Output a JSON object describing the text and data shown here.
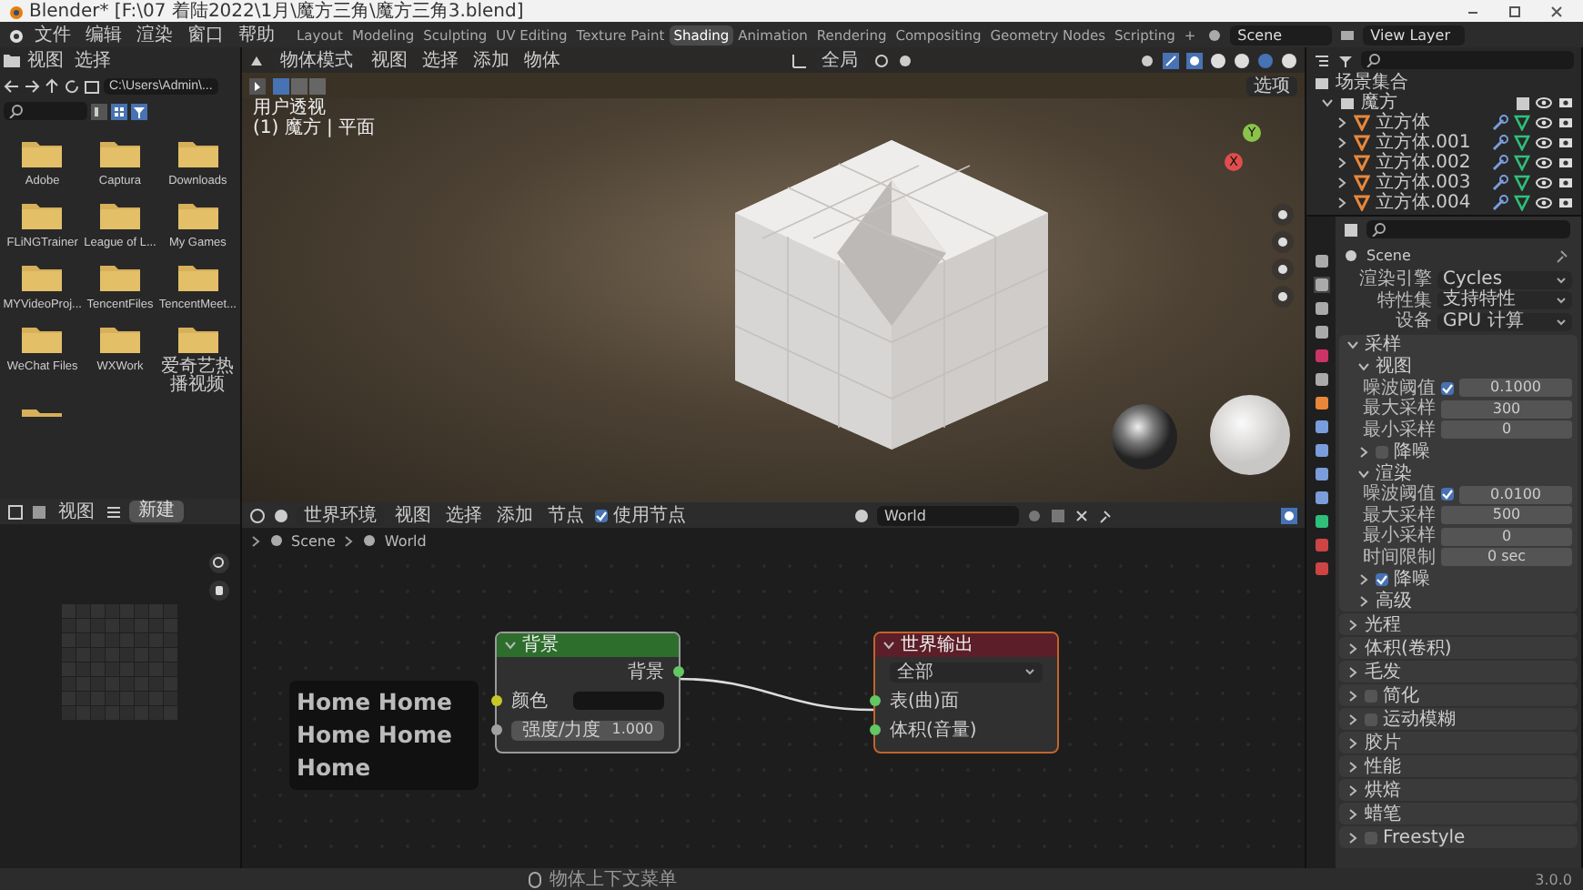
{
  "window": {
    "title": "Blender* [F:\\07 着陆2022\\1月\\魔方三角\\魔方三角3.blend]"
  },
  "menu": [
    "文件",
    "编辑",
    "渲染",
    "窗口",
    "帮助"
  ],
  "workspaces": [
    {
      "label": "Layout",
      "selected": false
    },
    {
      "label": "Modeling",
      "selected": false
    },
    {
      "label": "Sculpting",
      "selected": false
    },
    {
      "label": "UV Editing",
      "selected": false
    },
    {
      "label": "Texture Paint",
      "selected": false
    },
    {
      "label": "Shading",
      "selected": true
    },
    {
      "label": "Animation",
      "selected": false
    },
    {
      "label": "Rendering",
      "selected": false
    },
    {
      "label": "Compositing",
      "selected": false
    },
    {
      "label": "Geometry Nodes",
      "selected": false
    },
    {
      "label": "Scripting",
      "selected": false
    }
  ],
  "add_workspace": "+",
  "scene": "Scene",
  "view_layer": "View Layer",
  "file_browser": {
    "menu": [
      "视图",
      "选择"
    ],
    "path": "C:\\Users\\Admin\\...",
    "folders": [
      "Adobe",
      "Captura",
      "Downloads",
      "FLiNGTrainer",
      "League of L...",
      "My Games",
      "MYVideoProj...",
      "TencentFiles",
      "TencentMeet...",
      "WeChat Files",
      "WXWork",
      "爱奇艺热播视频"
    ]
  },
  "image_editor": {
    "view_menu": "视图",
    "new_button": "新建"
  },
  "viewport": {
    "mode": "物体模式",
    "menu": [
      "视图",
      "选择",
      "添加",
      "物体"
    ],
    "orientation": "全局",
    "view_name": "用户透视",
    "object_info": "(1) 魔方 | 平面",
    "options": "选项",
    "gizmo_axes": [
      "Y",
      "X"
    ]
  },
  "node_editor": {
    "type": "世界环境",
    "menu": [
      "视图",
      "选择",
      "添加",
      "节点"
    ],
    "use_nodes": {
      "label": "使用节点",
      "checked": true
    },
    "world": "World",
    "breadcrumbs": [
      "Scene",
      "World"
    ],
    "keystrokes": "Home Home Home Home Home",
    "background_node": {
      "title": "背景",
      "output": "背景",
      "color_label": "颜色",
      "strength_label": "强度/力度",
      "strength": "1.000"
    },
    "output_node": {
      "title": "世界输出",
      "target": "全部",
      "inputs": [
        "表(曲)面",
        "体积(音量)"
      ]
    }
  },
  "outliner": {
    "root": "场景集合",
    "items": [
      {
        "label": "魔方",
        "expanded": true,
        "children": [
          {
            "label": "立方体",
            "expanded": false
          },
          {
            "label": "立方体.001",
            "expanded": false
          },
          {
            "label": "立方体.002",
            "expanded": false
          },
          {
            "label": "立方体.003",
            "expanded": false
          },
          {
            "label": "立方体.004",
            "expanded": false
          }
        ]
      }
    ]
  },
  "properties": {
    "context": "Scene",
    "fields": [
      {
        "label": "渲染引擎",
        "value": "Cycles"
      },
      {
        "label": "特性集",
        "value": "支持特性"
      },
      {
        "label": "设备",
        "value": "GPU 计算"
      }
    ],
    "panels": [
      {
        "label": "采样",
        "kind": "plain",
        "expanded": true,
        "subpanels": [
          {
            "label": "视图",
            "kind": "plain",
            "expanded": true,
            "rows": [
              {
                "kind": "check_number",
                "label": "噪波阈值",
                "checked": true,
                "value": "0.1000"
              },
              {
                "kind": "number",
                "label": "最大采样",
                "value": "300"
              },
              {
                "kind": "number",
                "label": "最小采样",
                "value": "0"
              }
            ]
          },
          {
            "label": "降噪",
            "kind": "check",
            "checked": false,
            "expanded": false
          },
          {
            "label": "渲染",
            "kind": "plain",
            "expanded": true,
            "rows": [
              {
                "kind": "check_number",
                "label": "噪波阈值",
                "checked": true,
                "value": "0.0100"
              },
              {
                "kind": "number",
                "label": "最大采样",
                "value": "500"
              },
              {
                "kind": "number",
                "label": "最小采样",
                "value": "0"
              },
              {
                "kind": "number",
                "label": "时间限制",
                "value": "0 sec"
              }
            ]
          },
          {
            "label": "降噪",
            "kind": "check",
            "checked": true,
            "expanded": false
          },
          {
            "label": "高级",
            "kind": "plain",
            "expanded": false
          }
        ]
      },
      {
        "label": "光程",
        "kind": "plain",
        "expanded": false
      },
      {
        "label": "体积(卷积)",
        "kind": "plain",
        "expanded": false
      },
      {
        "label": "毛发",
        "kind": "plain",
        "expanded": false
      },
      {
        "label": "简化",
        "kind": "check",
        "checked": false,
        "expanded": false
      },
      {
        "label": "运动模糊",
        "kind": "check",
        "checked": false,
        "expanded": false
      },
      {
        "label": "胶片",
        "kind": "plain",
        "expanded": false
      },
      {
        "label": "性能",
        "kind": "plain",
        "expanded": false
      },
      {
        "label": "烘焙",
        "kind": "plain",
        "expanded": false
      },
      {
        "label": "蜡笔",
        "kind": "plain",
        "expanded": false
      },
      {
        "label": "Freestyle",
        "kind": "check",
        "checked": false,
        "expanded": false
      }
    ]
  },
  "status_bar": {
    "hint": "物体上下文菜单",
    "version": "3.0.0"
  }
}
